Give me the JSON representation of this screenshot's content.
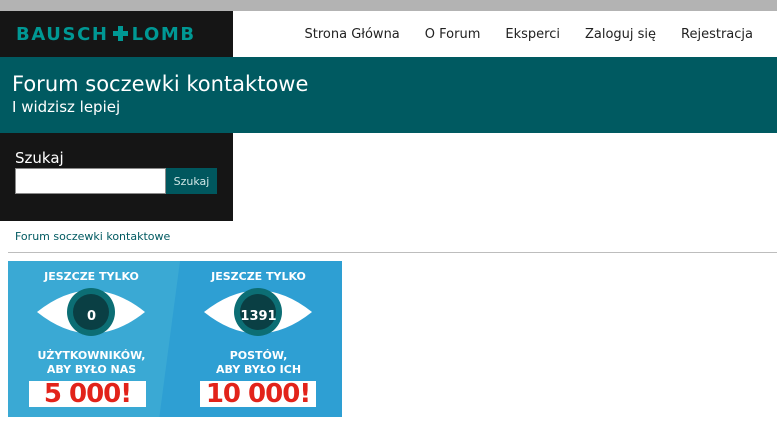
{
  "header": {
    "logo": {
      "left": "BAUSCH",
      "right": "LOMB"
    },
    "nav": [
      {
        "label": "Strona Główna"
      },
      {
        "label": "O Forum"
      },
      {
        "label": "Eksperci"
      },
      {
        "label": "Zaloguj się"
      },
      {
        "label": "Rejestracja"
      }
    ]
  },
  "banner": {
    "title": "Forum soczewki kontaktowe",
    "subtitle": "I widzisz lepiej"
  },
  "search": {
    "label": "Szukaj",
    "value": "",
    "button_label": "Szukaj"
  },
  "breadcrumb": "Forum soczewki kontaktowe",
  "promo": {
    "left": {
      "heading": "JESZCZE TYLKO",
      "count": "0",
      "caption_line1": "UŻYTKOWNIKÓW,",
      "caption_line2": "ABY BYŁO NAS",
      "goal": "5 000!"
    },
    "right": {
      "heading": "JESZCZE TYLKO",
      "count": "1391",
      "caption_line1": "POSTÓW,",
      "caption_line2": "ABY BYŁO ICH",
      "goal": "10 000!"
    }
  },
  "colors": {
    "brand_teal": "#005a61",
    "logo_green": "#009894",
    "dark_panel": "#151515",
    "promo_blue": "#2e9fd3",
    "goal_red": "#e2231a"
  }
}
